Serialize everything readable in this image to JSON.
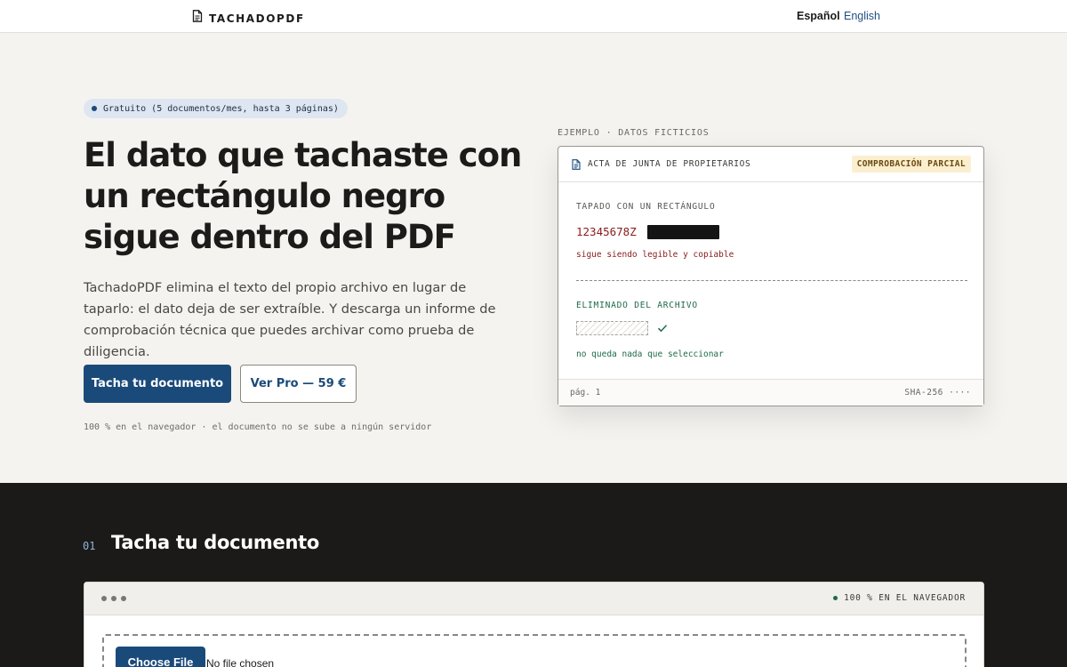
{
  "header": {
    "brand": "TACHADOPDF",
    "brand_icon": "document-icon",
    "lang_active": "Español",
    "lang_other": "English"
  },
  "hero": {
    "pill": "Gratuito (5 documentos/mes, hasta 3 páginas)",
    "title": "El dato que tachaste con un rectángulo negro sigue dentro del PDF",
    "description": "TachadoPDF elimina el texto del propio archivo en lugar de taparlo: el dato deja de ser extraíble. Y descarga un informe de comprobación técnica que puedes archivar como prueba de diligencia.",
    "cta_primary": "Tacha tu documento",
    "cta_secondary": "Ver Pro — 59 €",
    "note": "100 % en el navegador · el documento no se sube a ningún servidor"
  },
  "example": {
    "label": "EJEMPLO · DATOS FICTICIOS",
    "card_title": "ACTA DE JUNTA DE PROPIETARIOS",
    "badge": "COMPROBACIÓN PARCIAL",
    "covered_label": "TAPADO CON UN RECTÁNGULO",
    "dni": "12345678Z",
    "covered_note": "sigue siendo legible y copiable",
    "removed_label": "ELIMINADO DEL ARCHIVO",
    "removed_note": "no queda nada que seleccionar",
    "page": "pág. 1",
    "hash": "SHA-256 ····"
  },
  "tool": {
    "step_number": "01",
    "step_title": "Tacha tu documento",
    "status": "100 % EN EL NAVEGADOR",
    "file_button": "Choose File",
    "file_status": "No file chosen"
  },
  "colors": {
    "accent": "#1a4a7a",
    "danger": "#8a1a1a",
    "success": "#1e6a47",
    "dark_bg": "#1c1a18"
  }
}
